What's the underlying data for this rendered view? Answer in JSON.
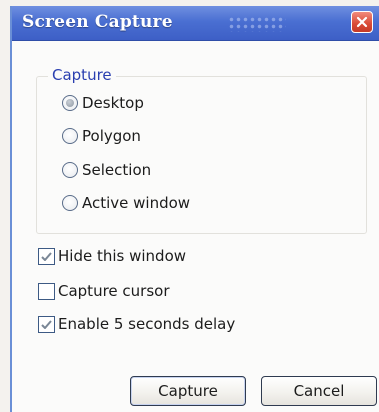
{
  "window": {
    "title": "Screen Capture"
  },
  "capture_group": {
    "label": "Capture",
    "options": [
      {
        "label": "Desktop",
        "selected": true
      },
      {
        "label": "Polygon",
        "selected": false
      },
      {
        "label": "Selection",
        "selected": false
      },
      {
        "label": "Active window",
        "selected": false
      }
    ]
  },
  "checkboxes": [
    {
      "label": "Hide this window",
      "checked": true
    },
    {
      "label": "Capture cursor",
      "checked": false
    },
    {
      "label": "Enable 5 seconds delay",
      "checked": true
    }
  ],
  "buttons": {
    "capture_label": "Capture",
    "cancel_label": "Cancel"
  },
  "icons": {
    "close": "close-icon",
    "radio": "radio-icon",
    "check": "checkmark-icon"
  },
  "colors": {
    "titlebar": "#4a6fd2",
    "close_button": "#d94a36",
    "group_label": "#2a3fb0",
    "background": "#fbfbfa"
  }
}
